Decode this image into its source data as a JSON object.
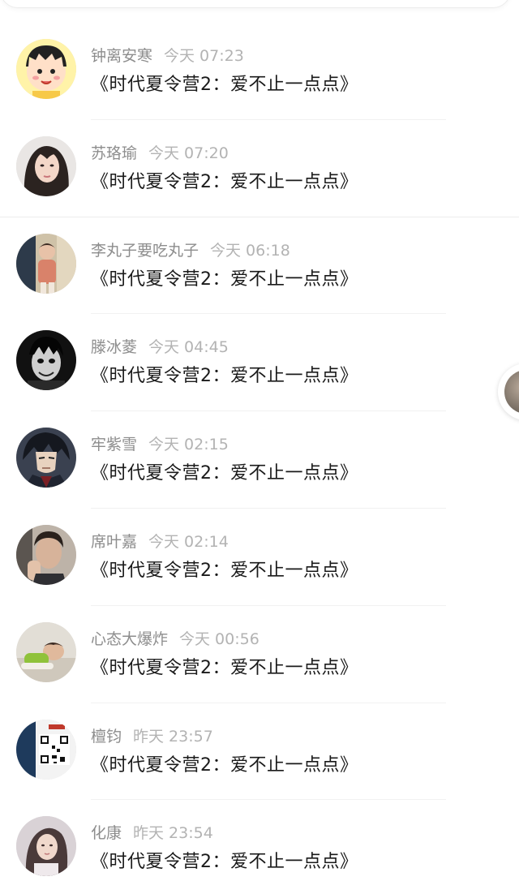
{
  "comments": [
    {
      "name": "钟离安寒",
      "time": "今天 07:23",
      "text": "《时代夏令营2：爱不止一点点》",
      "avatar_icon": "cartoon-girl-avatar"
    },
    {
      "name": "苏珞瑜",
      "time": "今天 07:20",
      "text": "《时代夏令营2：爱不止一点点》",
      "avatar_icon": "girl-portrait-avatar"
    },
    {
      "name": "李丸子要吃丸子",
      "time": "今天 06:18",
      "text": "《时代夏令营2：爱不止一点点》",
      "avatar_icon": "child-photo-avatar"
    },
    {
      "name": "滕冰菱",
      "time": "今天 04:45",
      "text": "《时代夏令营2：爱不止一点点》",
      "avatar_icon": "dark-horror-avatar"
    },
    {
      "name": "牢紫雪",
      "time": "今天 02:15",
      "text": "《时代夏令营2：爱不止一点点》",
      "avatar_icon": "anime-man-avatar"
    },
    {
      "name": "席叶嘉",
      "time": "今天 02:14",
      "text": "《时代夏令营2：爱不止一点点》",
      "avatar_icon": "man-hand-photo-avatar"
    },
    {
      "name": "心态大爆炸",
      "time": "今天 00:56",
      "text": "《时代夏令营2：爱不止一点点》",
      "avatar_icon": "lying-child-avatar"
    },
    {
      "name": "檀钧",
      "time": "昨天 23:57",
      "text": "《时代夏令营2：爱不止一点点》",
      "avatar_icon": "qr-code-avatar"
    },
    {
      "name": "化康",
      "time": "昨天 23:54",
      "text": "《时代夏令营2：爱不止一点点》",
      "avatar_icon": "woman-photo-avatar"
    }
  ],
  "colors": {
    "name": "#8d8d8d",
    "time": "#b3b3b3",
    "text": "#1a1a1a",
    "divider": "#f1f1f1"
  }
}
